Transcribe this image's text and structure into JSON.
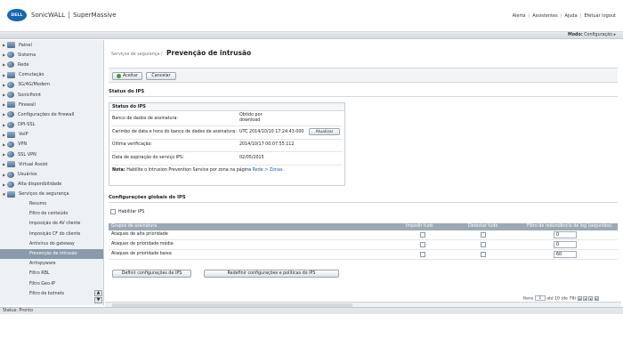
{
  "header": {
    "logo": "DELL",
    "brand": "SonicWALL",
    "product": "SuperMassive",
    "links": [
      "Alerta",
      "Assistentes",
      "Ajuda",
      "Efetuar logout"
    ]
  },
  "modebar": {
    "label": "Modo:",
    "value": "Configuração ▸"
  },
  "sidebar": {
    "items": [
      {
        "label": "Painel",
        "icon": "dashboard-icon"
      },
      {
        "label": "Sistema",
        "icon": "system-icon"
      },
      {
        "label": "Rede",
        "icon": "network-icon"
      },
      {
        "label": "Comutação",
        "icon": "switching-icon"
      },
      {
        "label": "3G/4G/Modem",
        "icon": "modem-icon"
      },
      {
        "label": "SonicPoint",
        "icon": "sonicpoint-icon"
      },
      {
        "label": "Firewall",
        "icon": "firewall-icon"
      },
      {
        "label": "Configurações de firewall",
        "icon": "firewall-settings-icon"
      },
      {
        "label": "DPI-SSL",
        "icon": "dpi-ssl-icon"
      },
      {
        "label": "VoIP",
        "icon": "voip-icon"
      },
      {
        "label": "VPN",
        "icon": "vpn-icon"
      },
      {
        "label": "SSL VPN",
        "icon": "ssl-vpn-icon"
      },
      {
        "label": "Virtual Assist",
        "icon": "virtual-assist-icon"
      },
      {
        "label": "Usuários",
        "icon": "users-icon"
      },
      {
        "label": "Alta disponibilidade",
        "icon": "high-availability-icon"
      },
      {
        "label": "Serviços de segurança",
        "icon": "security-services-icon"
      }
    ],
    "subitems": [
      "Resumo",
      "Filtro de conteúdo",
      "Imposição de AV cliente",
      "Imposição CF do cliente",
      "Antivírus do gateway",
      "Prevenção de intrusão",
      "Antispyware",
      "Filtro RBL",
      "Filtro Geo-IP",
      "Filtro de botnets"
    ],
    "active_subitem": "Prevenção de intrusão"
  },
  "status": "Status: Pronto",
  "main": {
    "breadcrumb": "Serviços de segurança /",
    "title": "Prevenção de intrusão",
    "accept": "Aceitar",
    "cancel": "Cancelar",
    "ips_status_section": "Status do IPS",
    "ips_box_title": "Status do IPS",
    "ips_rows": [
      {
        "label": "Banco de dados de assinatura:",
        "value": "Obtido por download"
      },
      {
        "label": "Carimbo de data e hora do banco de dados de assinatura:",
        "value": "UTC 2014/10/10 17:24:43.000"
      },
      {
        "label": "Última verificação:",
        "value": "2014/10/17 00:07:55.112"
      },
      {
        "label": "Data de expiração do serviço IPS:",
        "value": "02/05/2015"
      }
    ],
    "update_button": "Atualizar",
    "note_prefix": "Nota:",
    "note_text": "Habilite o Intrusion Prevention Service por zona na página",
    "note_link": "Rede > Zonas.",
    "global_section": "Configurações globais do IPS",
    "enable_ips": "Habilitar IPS",
    "table": {
      "headers": [
        "Grupos de assinatura",
        "Impedir tudo",
        "Detectar tudo",
        "Filtro de redundância de log (segundos)"
      ],
      "rows": [
        {
          "label": "Ataques de alta prioridade",
          "value": "0"
        },
        {
          "label": "Ataques de prioridade média",
          "value": "0"
        },
        {
          "label": "Ataques de prioridade baixa",
          "value": "60"
        }
      ]
    },
    "define_button": "Definir configurações de IPS",
    "reset_button": "Redefinir configurações e políticas do IPS",
    "pager": {
      "label": "Itens",
      "value": "1",
      "suffix": "até 10 (de 78)"
    }
  }
}
